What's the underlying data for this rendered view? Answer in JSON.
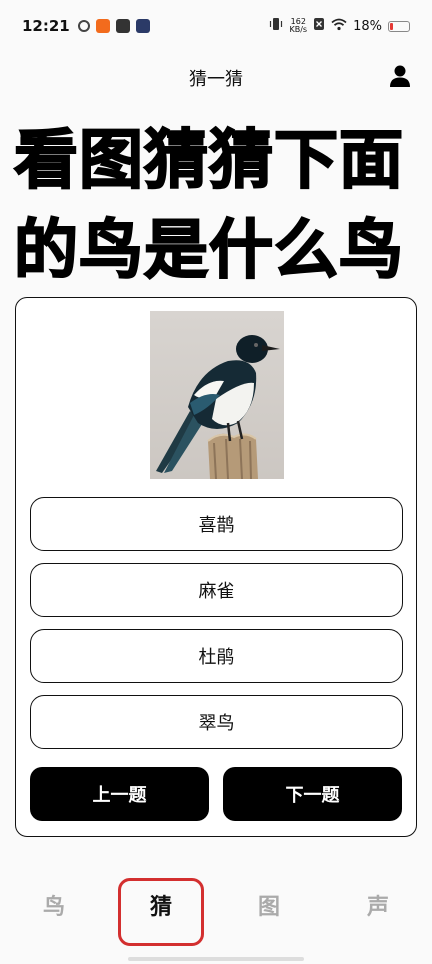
{
  "status_bar": {
    "time": "12:21",
    "net_speed_value": "162",
    "net_speed_unit": "KB/s",
    "battery_text": "18%",
    "battery_level": 0.18,
    "battery_color": "#e53935"
  },
  "header": {
    "title": "猜一猜"
  },
  "main": {
    "title": "看图猜猜下面\n的鸟是什么鸟",
    "options": [
      "喜鹊",
      "麻雀",
      "杜鹃",
      "翠鸟"
    ],
    "prev_label": "上一题",
    "next_label": "下一题"
  },
  "tabs": [
    {
      "label": "鸟",
      "active": false
    },
    {
      "label": "猜",
      "active": true
    },
    {
      "label": "图",
      "active": false
    },
    {
      "label": "声",
      "active": false
    }
  ],
  "colors": {
    "highlight": "#d32f2f",
    "button_bg": "#000000",
    "button_text": "#ffffff"
  }
}
